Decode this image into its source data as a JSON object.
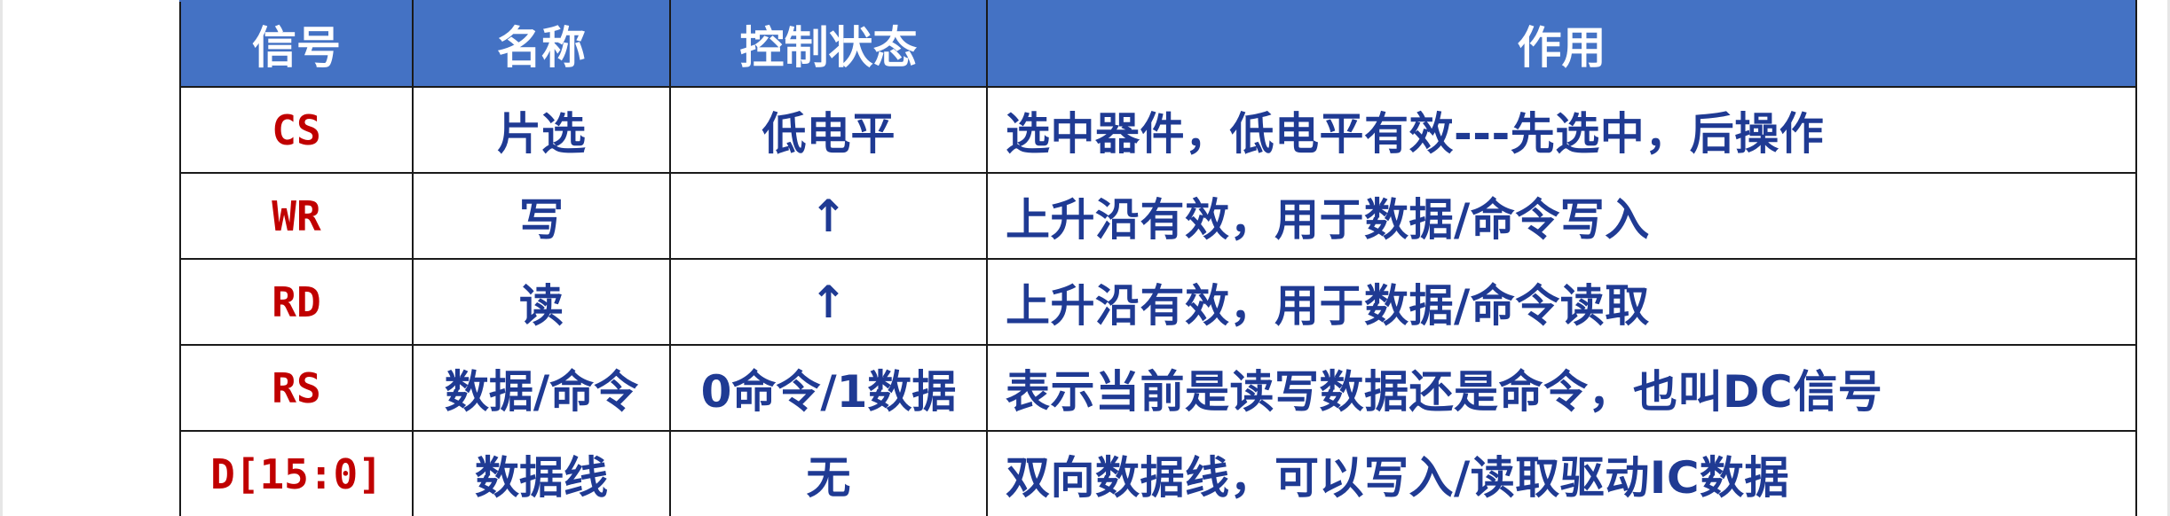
{
  "table": {
    "headers": [
      "信号",
      "名称",
      "控制状态",
      "作用"
    ],
    "rows": [
      {
        "signal": "CS",
        "name": "片选",
        "control": "低电平",
        "function": "选中器件，低电平有效---先选中，后操作"
      },
      {
        "signal": "WR",
        "name": "写",
        "control": "↑",
        "function": "上升沿有效，用于数据/命令写入"
      },
      {
        "signal": "RD",
        "name": "读",
        "control": "↑",
        "function": "上升沿有效，用于数据/命令读取"
      },
      {
        "signal": "RS",
        "name": "数据/命令",
        "control": "0命令/1数据",
        "function": "表示当前是读写数据还是命令，也叫DC信号"
      },
      {
        "signal": "D[15:0]",
        "name": "数据线",
        "control": "无",
        "function": "双向数据线，可以写入/读取驱动IC数据"
      }
    ]
  },
  "colors": {
    "header_bg": "#4472c4",
    "header_text": "#ffffff",
    "signal_text": "#c00000",
    "body_text": "#1f3a93",
    "border": "#1a1a1a"
  }
}
